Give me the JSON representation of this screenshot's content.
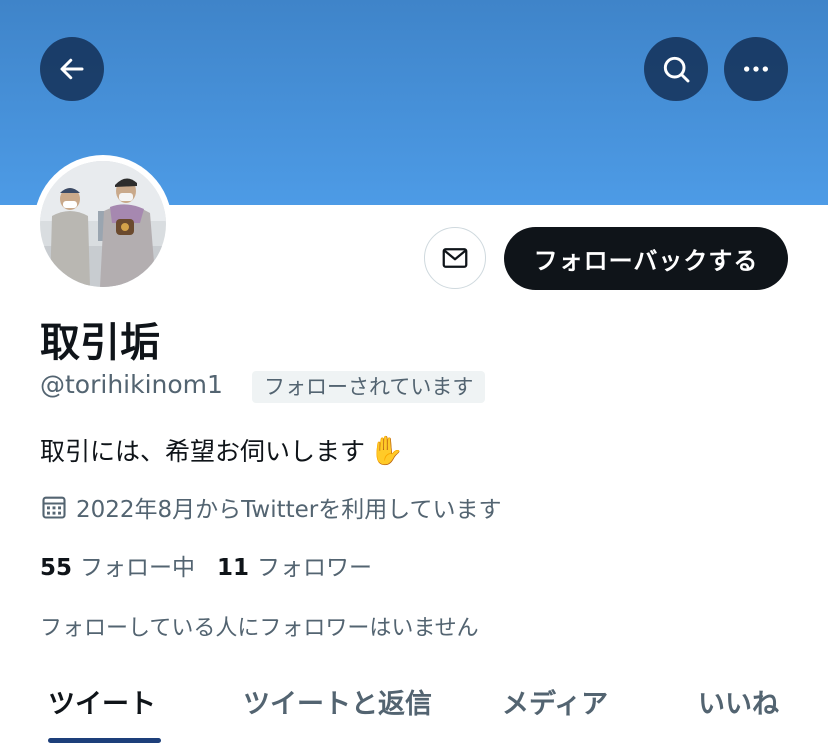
{
  "header": {
    "back_icon": "arrow-left-icon",
    "search_icon": "search-icon",
    "more_icon": "more-horizontal-icon"
  },
  "profile": {
    "display_name": "取引垢",
    "handle": "@torihikinom1",
    "follows_you_badge": "フォローされています",
    "bio": "取引には、希望お伺いします",
    "bio_emoji": "✋",
    "joined": "2022年8月からTwitterを利用しています",
    "following_count": "55",
    "following_label": "フォロー中",
    "followers_count": "11",
    "followers_label": "フォロワー",
    "mutuals_note": "フォローしている人にフォロワーはいません"
  },
  "actions": {
    "follow_back_label": "フォローバックする",
    "message_icon": "mail-icon"
  },
  "tabs": [
    {
      "label": "ツイート",
      "active": true
    },
    {
      "label": "ツイートと返信",
      "active": false
    },
    {
      "label": "メディア",
      "active": false
    },
    {
      "label": "いいね",
      "active": false
    }
  ],
  "colors": {
    "banner": "#4a94dd",
    "button": "#0f1419",
    "secondary_text": "#536471",
    "tab_indicator": "#1d3f7a"
  }
}
